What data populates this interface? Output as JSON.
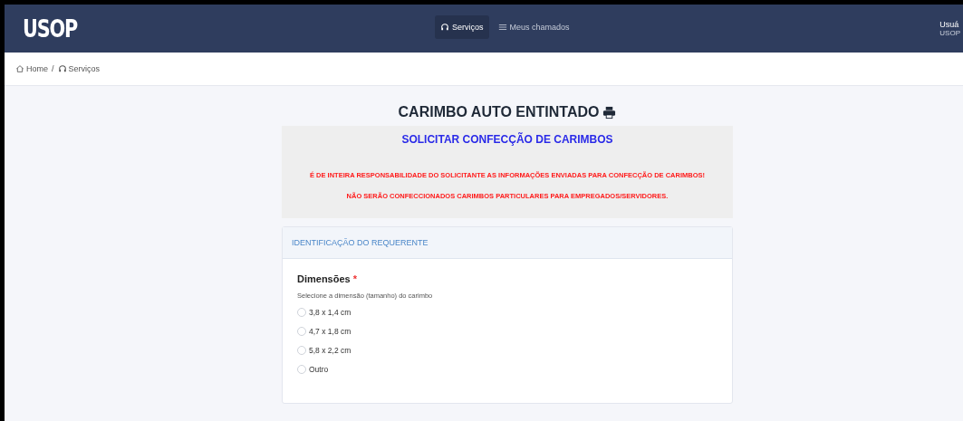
{
  "header": {
    "logo": "USOP",
    "nav": [
      {
        "label": "Serviços",
        "selected": true
      },
      {
        "label": "Meus chamados",
        "selected": false
      }
    ],
    "user": {
      "name": "Usuá",
      "org": "USOP"
    }
  },
  "breadcrumb": [
    {
      "label": "Home"
    },
    {
      "separator": "/",
      "label": "Serviços"
    }
  ],
  "page_title": "CARIMBO AUTO ENTINTADO",
  "notice": {
    "title": "SOLICITAR CONFECÇÃO DE CARIMBOS",
    "warnings": [
      "É DE INTEIRA RESPONSABILIDADE DO SOLICITANTE AS INFORMAÇÕES ENVIADAS PARA CONFECÇÃO DE CARIMBOS!",
      "NÃO SERÃO CONFECCIONADOS CARIMBOS PARTICULARES PARA EMPREGADOS/SERVIDORES."
    ]
  },
  "section": {
    "title": "IDENTIFICAÇÃO DO REQUERENTE",
    "field": {
      "label": "Dimensões",
      "required": "*",
      "help": "Selecione a dimensão (tamanho) do carimbo",
      "options": [
        {
          "label": "3,8 x 1,4 cm",
          "selected": false
        },
        {
          "label": "4,7 x 1,8 cm",
          "selected": false
        },
        {
          "label": "5,8 x 2,2 cm",
          "selected": false
        },
        {
          "label": "Outro",
          "selected": false
        }
      ]
    }
  }
}
